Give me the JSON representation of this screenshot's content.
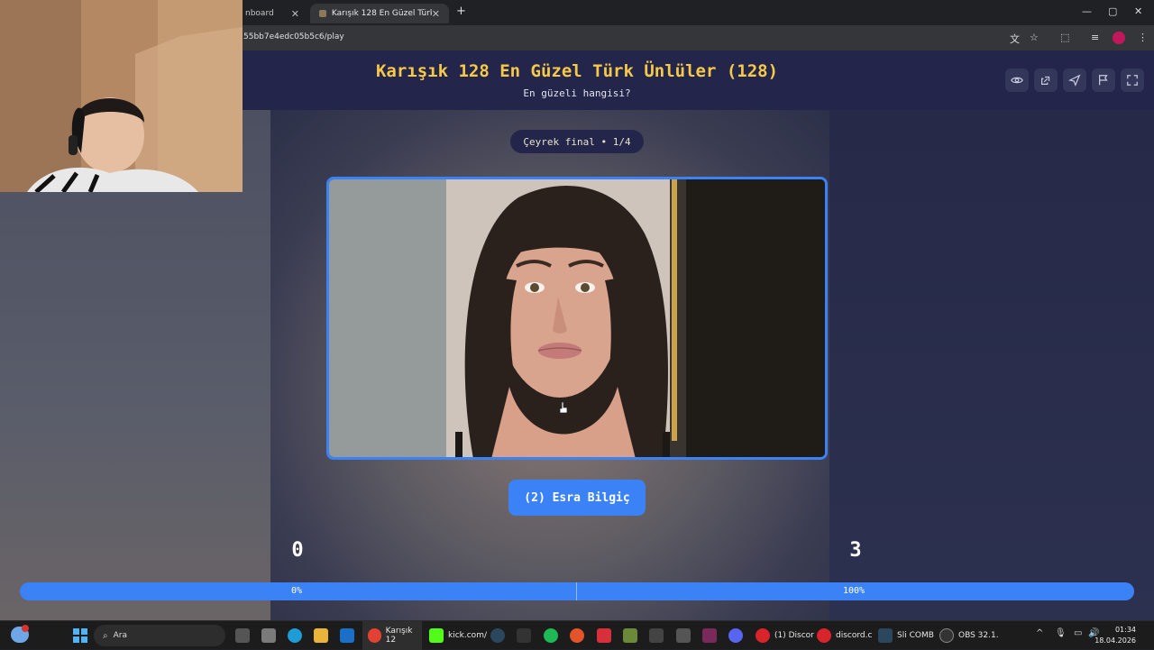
{
  "browser": {
    "tabs": [
      {
        "label": "nboard",
        "active": false
      },
      {
        "label": "Karışık 128 En Güzel Türk Ünlüle",
        "active": true
      }
    ],
    "new_tab": "+",
    "url": "55bb7e4edc05b5c6/play",
    "window_controls": [
      "—",
      "▢",
      "✕"
    ]
  },
  "header": {
    "title": "Karışık 128 En Güzel Türk Ünlüler (128)",
    "subtitle": "En güzeli hangisi?",
    "buttons": [
      "eye-icon",
      "share-icon",
      "send-icon",
      "flag-icon",
      "fullscreen-icon"
    ]
  },
  "round": {
    "label": "Çeyrek final • 1/4"
  },
  "contestant": {
    "name_button": "(2) Esra Bilgiç"
  },
  "scores": {
    "left": "0",
    "right": "3"
  },
  "progress": {
    "left_label": "0%",
    "right_label": "100%",
    "value": 0.5
  },
  "taskbar": {
    "search_label": "Ara",
    "items": [
      {
        "label": "Karışık 12"
      },
      {
        "label": "kick.com/"
      },
      {
        "label": "(1) Discor"
      },
      {
        "label": "discord.c"
      },
      {
        "label": "Sli COMB"
      },
      {
        "label": "OBS 32.1."
      }
    ],
    "time": "01:34",
    "date": "18.04.2026"
  },
  "colors": {
    "accent": "#3b82f6",
    "title": "#f7c948",
    "header_bg": "#23264a"
  }
}
